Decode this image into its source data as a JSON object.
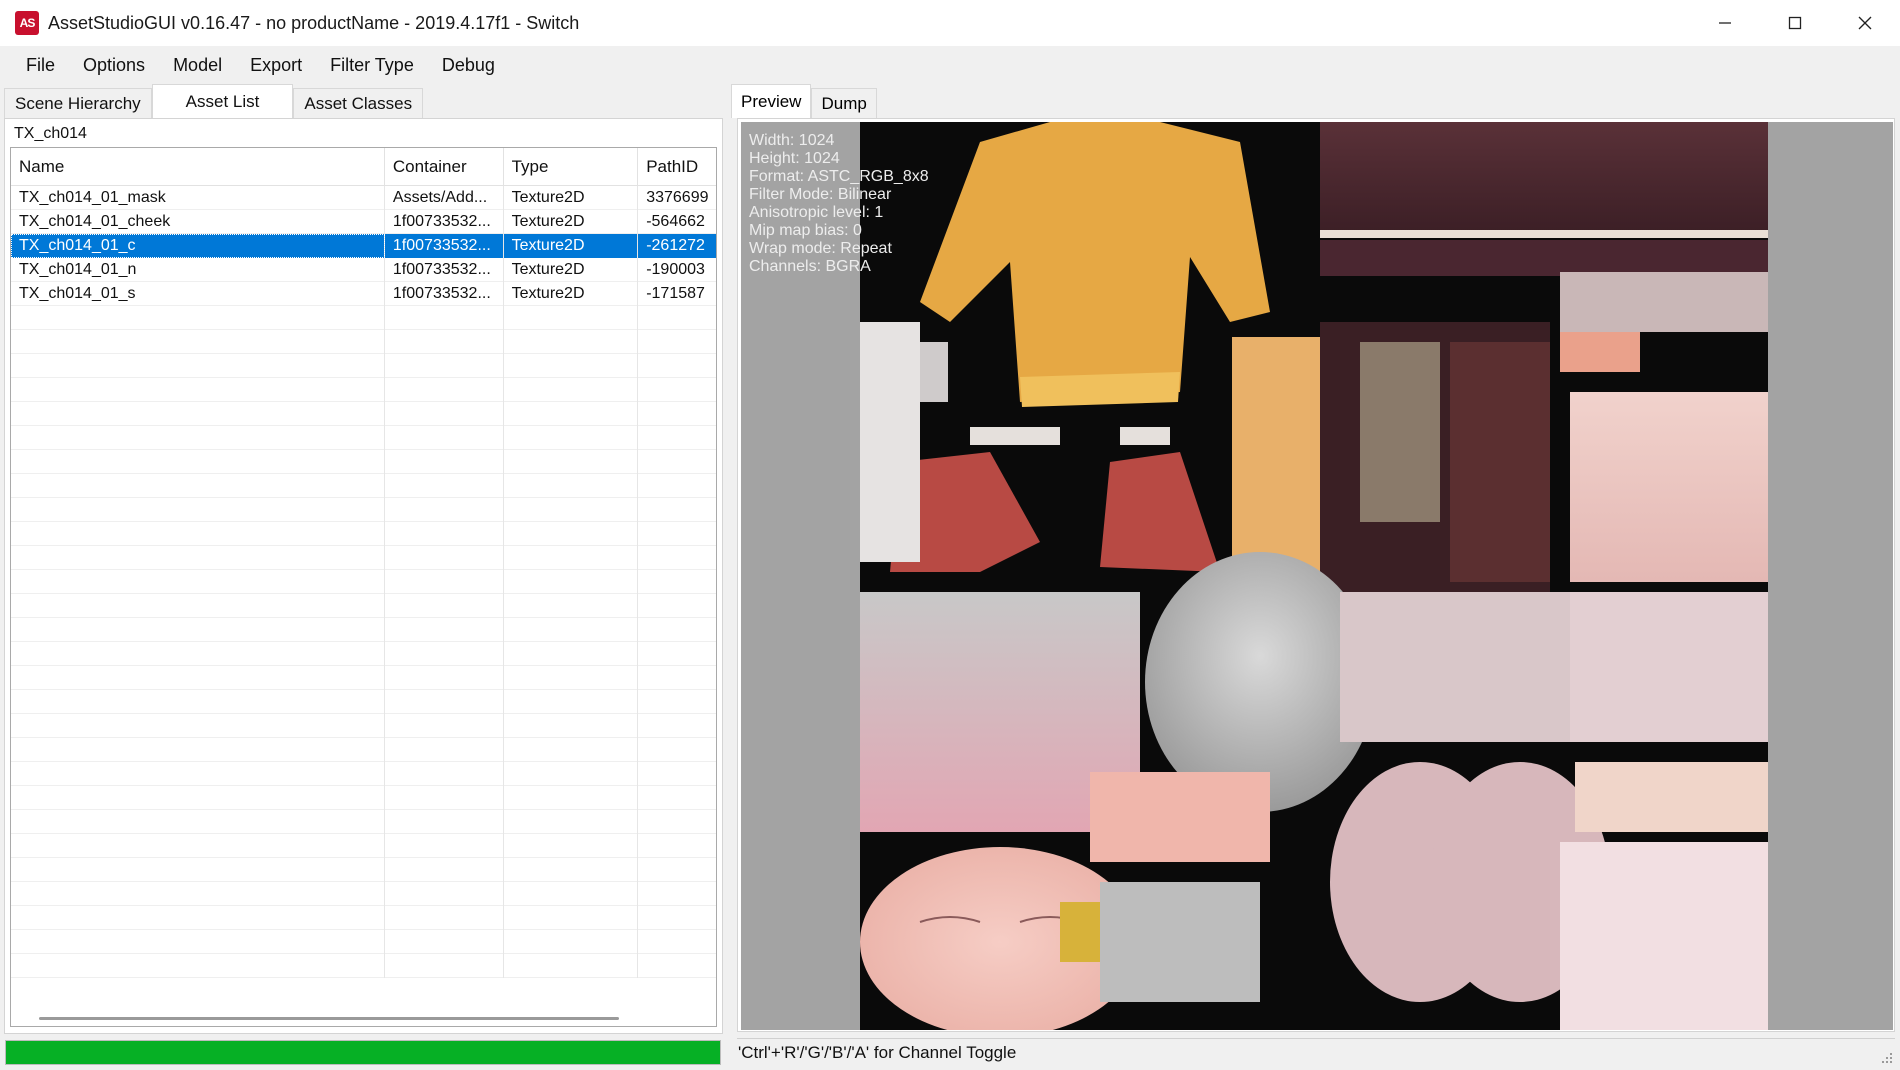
{
  "window": {
    "icon_text": "AS",
    "title": "AssetStudioGUI v0.16.47 - no productName - 2019.4.17f1 - Switch"
  },
  "menu": [
    "File",
    "Options",
    "Model",
    "Export",
    "Filter Type",
    "Debug"
  ],
  "left_tabs": [
    "Scene Hierarchy",
    "Asset List",
    "Asset Classes"
  ],
  "filter_text": "TX_ch014",
  "columns": [
    "Name",
    "Container",
    "Type",
    "PathID"
  ],
  "rows": [
    {
      "name": "TX_ch014_01_mask",
      "container": "Assets/Add...",
      "type": "Texture2D",
      "pathid": "3376699"
    },
    {
      "name": "TX_ch014_01_cheek",
      "container": "1f00733532...",
      "type": "Texture2D",
      "pathid": "-564662"
    },
    {
      "name": "TX_ch014_01_c",
      "container": "1f00733532...",
      "type": "Texture2D",
      "pathid": "-261272",
      "selected": true
    },
    {
      "name": "TX_ch014_01_n",
      "container": "1f00733532...",
      "type": "Texture2D",
      "pathid": "-190003"
    },
    {
      "name": "TX_ch014_01_s",
      "container": "1f00733532...",
      "type": "Texture2D",
      "pathid": "-171587"
    }
  ],
  "progress": 1.0,
  "right_tabs": [
    "Preview",
    "Dump"
  ],
  "texture_info": [
    "Width: 1024",
    "Height: 1024",
    "Format: ASTC_RGB_8x8",
    "Filter Mode: Bilinear",
    "Anisotropic level: 1",
    "Mip map bias: 0",
    "Wrap mode: Repeat",
    "Channels: BGRA"
  ],
  "status": "'Ctrl'+'R'/'G'/'B'/'A' for Channel Toggle",
  "colors": {
    "selection": "#0078d7",
    "progress": "#06b025",
    "preview_bg": "#a3a3a3",
    "texture_bg": "#0a0a0a"
  },
  "icons": [
    "app-icon",
    "minimize-icon",
    "maximize-icon",
    "close-icon",
    "size-grip-icon"
  ]
}
